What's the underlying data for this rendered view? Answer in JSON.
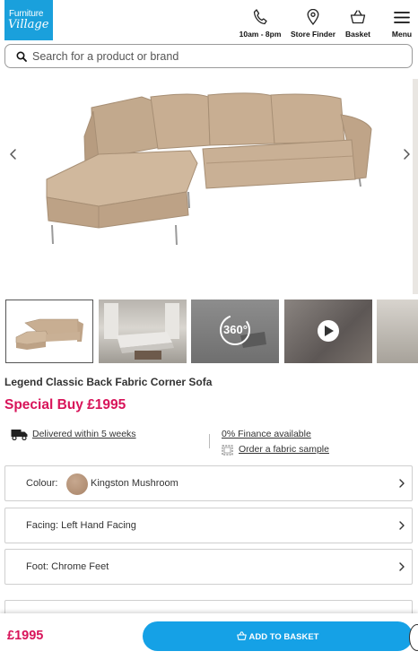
{
  "header": {
    "logo_line1": "Furniture",
    "logo_line2": "Village",
    "phone_label": "10am - 8pm",
    "store_finder_label": "Store Finder",
    "basket_label": "Basket",
    "menu_label": "Menu"
  },
  "search": {
    "placeholder": "Search for a product or brand"
  },
  "gallery": {
    "thumbnail_360_label": "360°"
  },
  "product": {
    "name": "Legend Classic Back Fabric Corner Sofa",
    "price_label": "Special Buy £1995",
    "delivery_text": "Delivered within 5 weeks",
    "finance_text": "0% Finance available",
    "sample_text": "Order a fabric sample"
  },
  "options": {
    "colour_label": "Colour:",
    "colour_value": "Kingston Mushroom",
    "facing_label": "Facing: Left Hand Facing",
    "foot_label": "Foot: Chrome Feet"
  },
  "sticky_bar": {
    "price": "£1995",
    "add_to_basket_label": "ADD TO BASKET"
  },
  "colors": {
    "brand_blue": "#15a1e6",
    "price_pink": "#d8145a",
    "sofa_fabric": "#c8ae92"
  },
  "icons": [
    "phone-icon",
    "map-pin-icon",
    "basket-icon",
    "hamburger-menu-icon",
    "search-icon",
    "chevron-left-icon",
    "chevron-right-icon",
    "truck-icon",
    "fabric-sample-icon",
    "play-icon"
  ]
}
